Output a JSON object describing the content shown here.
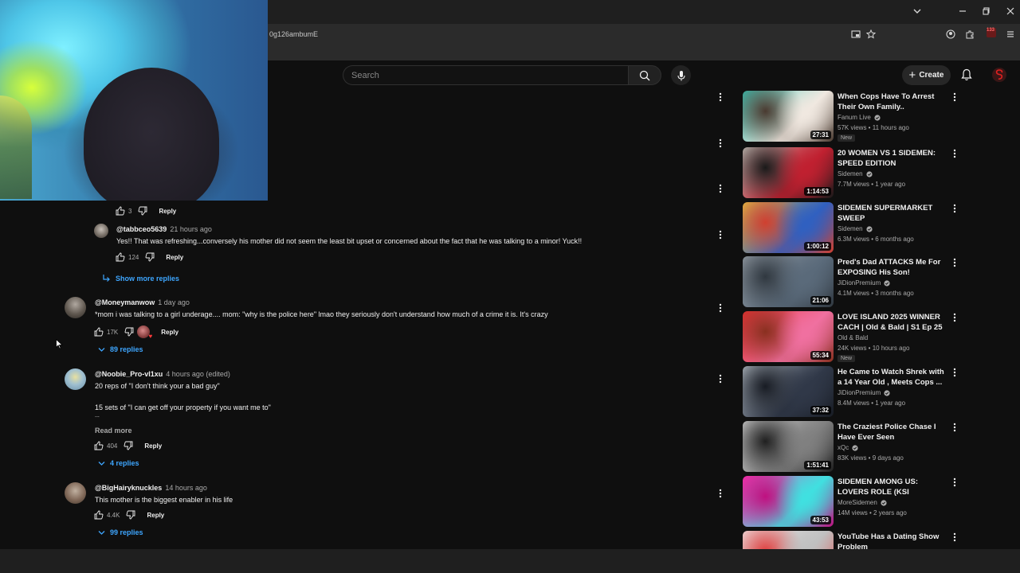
{
  "browser": {
    "url": "0g126ambumE",
    "extension_badge": "133"
  },
  "header": {
    "search_placeholder": "Search",
    "create_label": "Create"
  },
  "comments": [
    {
      "likes": "3",
      "reply_label": "Reply"
    },
    {
      "handle": "@tabbceo5639",
      "time": "21 hours ago",
      "text": "Yes!! That was refreshing...conversely his mother did not seem the least bit upset or concerned about the fact that he was talking to a minor! Yuck!!",
      "likes": "124",
      "reply_label": "Reply"
    },
    {
      "show_more_label": "Show more replies"
    },
    {
      "handle": "@Moneymanwow",
      "time": "1 day ago",
      "text": "*mom i was talking to a girl underage.... mom: \"why is the police here\" lmao they seriously don't understand how much of a crime it is. It's crazy",
      "likes": "17K",
      "reply_label": "Reply",
      "replies_label": "89 replies"
    },
    {
      "handle": "@Noobie_Pro-vl1xu",
      "time": "4 hours ago (edited)",
      "text_line1": "20 reps of \"I don't think your a bad guy\"",
      "text_line2": "15 sets of \"I can get off your property if you want me to\"",
      "text_line3": "...",
      "read_more": "Read more",
      "likes": "404",
      "reply_label": "Reply",
      "replies_label": "4 replies"
    },
    {
      "handle": "@BigHairyknuckles",
      "time": "14 hours ago",
      "text": "This mother is the biggest enabler in his life",
      "likes": "4.4K",
      "reply_label": "Reply",
      "replies_label": "99 replies"
    }
  ],
  "sidebar": [
    {
      "title": "When Cops Have To Arrest Their Own Family..",
      "channel": "Fanum Live",
      "verified": true,
      "meta": "57K views • 11 hours ago",
      "badge": "New",
      "duration": "27:31",
      "thumb_colors": [
        "#35c8b8",
        "#f0e8e0",
        "#4a3a30"
      ]
    },
    {
      "title": "20 WOMEN VS 1 SIDEMEN: SPEED EDITION",
      "channel": "Sidemen",
      "verified": true,
      "meta": "7.7M views • 1 year ago",
      "badge": "",
      "duration": "1:14:53",
      "thumb_colors": [
        "#d8d0c8",
        "#c02030",
        "#1a1a1a"
      ]
    },
    {
      "title": "SIDEMEN SUPERMARKET SWEEP",
      "channel": "Sidemen",
      "verified": true,
      "meta": "6.3M views • 6 months ago",
      "badge": "",
      "duration": "1:00:12",
      "thumb_colors": [
        "#e8c840",
        "#3060c0",
        "#d04030"
      ]
    },
    {
      "title": "Pred's Dad ATTACKS Me For EXPOSING His Son!",
      "channel": "JiDionPremium",
      "verified": true,
      "meta": "4.1M views • 3 months ago",
      "badge": "",
      "duration": "21:06",
      "thumb_colors": [
        "#a0a8b0",
        "#5a6a7a",
        "#303840"
      ]
    },
    {
      "title": "LOVE ISLAND 2025 WINNER CACH | Old & Bald | S1 Ep 25",
      "channel": "Old & Bald",
      "verified": false,
      "meta": "24K views • 10 hours ago",
      "badge": "New",
      "duration": "55:34",
      "thumb_colors": [
        "#e83030",
        "#f070a0",
        "#8a3020"
      ]
    },
    {
      "title": "He Came to Watch Shrek with a 14 Year Old , Meets Cops ...",
      "channel": "JiDionPremium",
      "verified": true,
      "meta": "8.4M views • 1 year ago",
      "badge": "",
      "duration": "37:32",
      "thumb_colors": [
        "#c0c8d0",
        "#303848",
        "#181c24"
      ]
    },
    {
      "title": "The Craziest Police Chase I Have Ever Seen",
      "channel": "xQc",
      "verified": true,
      "meta": "83K views • 9 days ago",
      "badge": "",
      "duration": "1:51:41",
      "thumb_colors": [
        "#e0e0e0",
        "#808080",
        "#202020"
      ]
    },
    {
      "title": "SIDEMEN AMONG US: LOVERS ROLE (KSI RETURNS)",
      "channel": "MoreSidemen",
      "verified": true,
      "meta": "14M views • 2 years ago",
      "badge": "",
      "duration": "43:53",
      "thumb_colors": [
        "#ff30b0",
        "#40e0e0",
        "#c01080"
      ]
    },
    {
      "title": "YouTube Has a Dating Show Problem",
      "channel": "",
      "verified": false,
      "meta": "",
      "badge": "",
      "duration": "",
      "thumb_colors": [
        "#f0f0f0",
        "#c0c0c0",
        "#e04040"
      ]
    }
  ]
}
